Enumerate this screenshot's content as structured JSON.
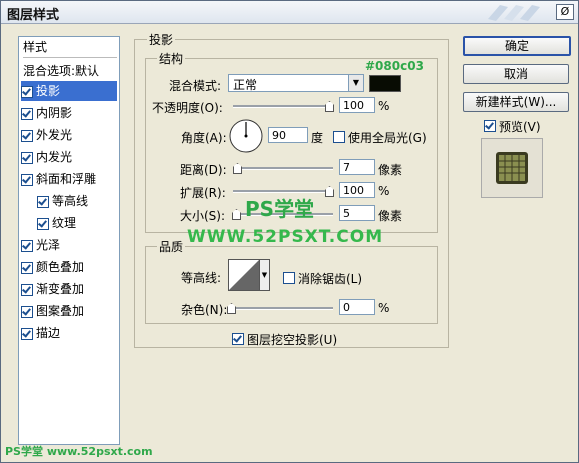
{
  "window": {
    "title": "图层样式",
    "close": "Ø"
  },
  "left_panel": {
    "header": "样式",
    "blend": "混合选项:默认",
    "items": [
      {
        "label": "投影",
        "checked": true,
        "selected": true
      },
      {
        "label": "内阴影",
        "checked": true
      },
      {
        "label": "外发光",
        "checked": true
      },
      {
        "label": "内发光",
        "checked": true
      },
      {
        "label": "斜面和浮雕",
        "checked": true
      },
      {
        "label": "等高线",
        "checked": true,
        "indent": true
      },
      {
        "label": "纹理",
        "checked": true,
        "indent": true
      },
      {
        "label": "光泽",
        "checked": true
      },
      {
        "label": "颜色叠加",
        "checked": true
      },
      {
        "label": "渐变叠加",
        "checked": true
      },
      {
        "label": "图案叠加",
        "checked": true
      },
      {
        "label": "描边",
        "checked": true
      }
    ]
  },
  "section": {
    "title": "投影",
    "structure_title": "结构",
    "quality_title": "品质"
  },
  "structure": {
    "blend_mode_label": "混合模式:",
    "blend_mode_value": "正常",
    "color_hex": "#080c03",
    "opacity_label": "不透明度(O):",
    "opacity_value": "100",
    "opacity_unit": "%",
    "angle_label": "角度(A):",
    "angle_value": "90",
    "angle_unit": "度",
    "global_light_label": "使用全局光(G)",
    "distance_label": "距离(D):",
    "distance_value": "7",
    "distance_unit": "像素",
    "spread_label": "扩展(R):",
    "spread_value": "100",
    "spread_unit": "%",
    "size_label": "大小(S):",
    "size_value": "5",
    "size_unit": "像素",
    "swatch_color": "#080c03"
  },
  "quality": {
    "contour_label": "等高线:",
    "anti_alias_label": "消除锯齿(L)",
    "noise_label": "杂色(N):",
    "noise_value": "0",
    "noise_unit": "%"
  },
  "knockout_label": "图层挖空投影(U)",
  "buttons": {
    "ok": "确定",
    "cancel": "取消",
    "new_style": "新建样式(W)...",
    "preview": "预览(V)"
  },
  "watermarks": {
    "ps": "PS学堂",
    "url": "WWW.52PSXT.COM",
    "footer": "PS学堂 www.52psxt.com"
  }
}
